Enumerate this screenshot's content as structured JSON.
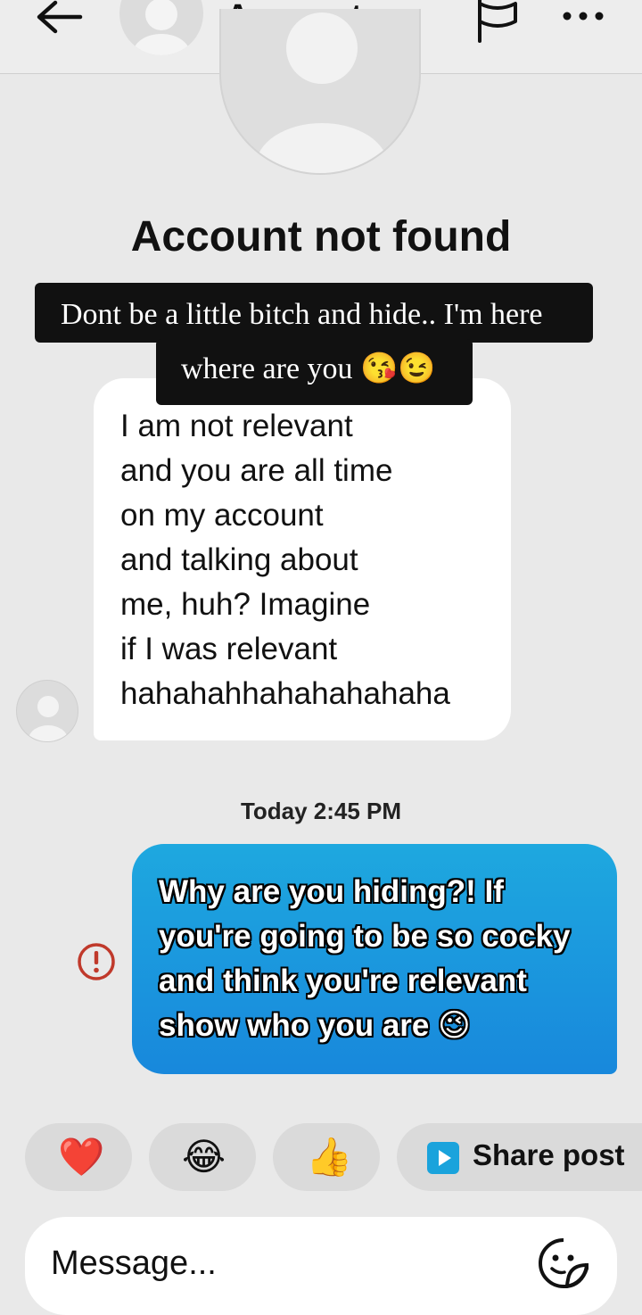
{
  "header": {
    "title": "Account n...",
    "back_icon": "arrow-left-icon",
    "flag_icon": "flag-icon",
    "more_icon": "more-horizontal-icon"
  },
  "profile": {
    "title": "Account not found"
  },
  "overlay_caption": {
    "line1": "Dont be a little bitch and hide.. I'm here",
    "line2": "where are you 😘😉"
  },
  "messages": {
    "incoming": {
      "lines": [
        "I am not relevant",
        "and you are all time",
        "on my account",
        "and talking about",
        "me, huh? Imagine",
        "if I was relevant",
        "hahahahhahahahahaha"
      ]
    },
    "timestamp": "Today 2:45 PM",
    "outgoing": {
      "lines": [
        "Why are you hiding?! If",
        "you're going to be so cocky",
        "and think you're relevant",
        "show who you are 😉"
      ],
      "status_icon": "error-icon",
      "bubble_color": "#1b97de"
    }
  },
  "quick_replies": {
    "heart": "❤️",
    "laugh": "😂",
    "thumbs_up": "👍",
    "share_label": "Share post",
    "share_icon": "play-square-icon"
  },
  "composer": {
    "placeholder": "Message...",
    "sticker_icon": "sticker-icon"
  },
  "colors": {
    "background": "#e9e9e9",
    "error": "#c0392b",
    "caption_bg": "#111111"
  }
}
